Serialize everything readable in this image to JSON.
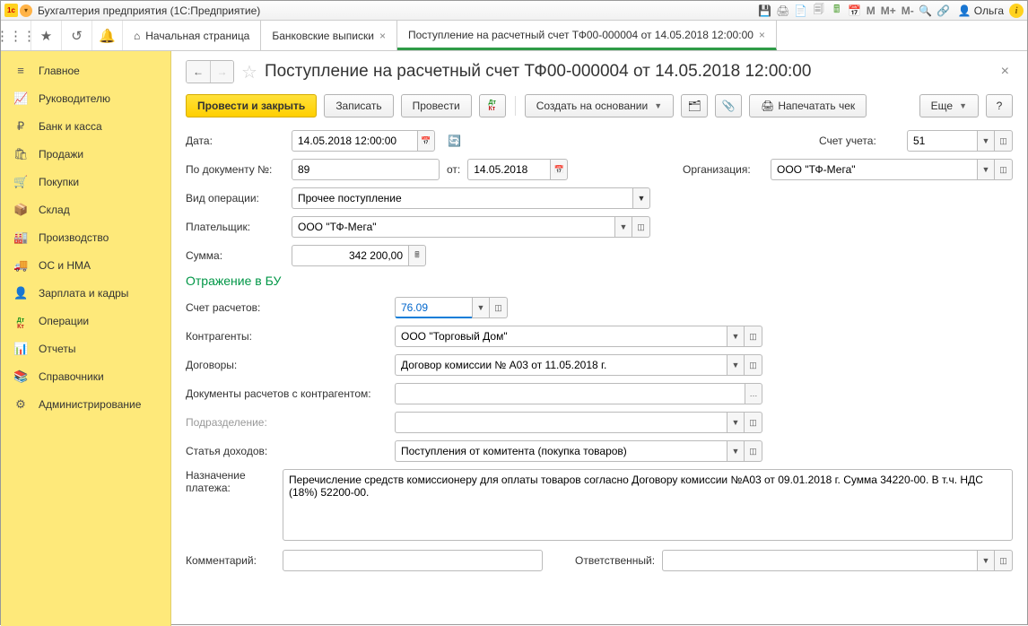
{
  "titlebar": {
    "app_title": "Бухгалтерия предприятия  (1С:Предприятие)",
    "user": "Ольга",
    "m": "М",
    "mplus": "М+",
    "mminus": "М-"
  },
  "tabs": {
    "home": "Начальная страница",
    "t1": "Банковские выписки",
    "t2": "Поступление на расчетный счет ТФ00-000004 от 14.05.2018 12:00:00"
  },
  "sidebar": [
    {
      "icon": "≡",
      "label": "Главное"
    },
    {
      "icon": "📈",
      "label": "Руководителю"
    },
    {
      "icon": "₽",
      "label": "Банк и касса"
    },
    {
      "icon": "🛍",
      "label": "Продажи"
    },
    {
      "icon": "🛒",
      "label": "Покупки"
    },
    {
      "icon": "📦",
      "label": "Склад"
    },
    {
      "icon": "🏭",
      "label": "Производство"
    },
    {
      "icon": "🚚",
      "label": "ОС и НМА"
    },
    {
      "icon": "👤",
      "label": "Зарплата и кадры"
    },
    {
      "icon": "Дт",
      "label": "Операции"
    },
    {
      "icon": "📊",
      "label": "Отчеты"
    },
    {
      "icon": "📚",
      "label": "Справочники"
    },
    {
      "icon": "⚙",
      "label": "Администрирование"
    }
  ],
  "page": {
    "title": "Поступление на расчетный счет ТФ00-000004 от 14.05.2018 12:00:00"
  },
  "toolbar": {
    "post_close": "Провести и закрыть",
    "write": "Записать",
    "post": "Провести",
    "create_based": "Создать на основании",
    "print_check": "Напечатать чек",
    "more": "Еще"
  },
  "form": {
    "date_lbl": "Дата:",
    "date_val": "14.05.2018 12:00:00",
    "acc_lbl": "Счет учета:",
    "acc_val": "51",
    "docnum_lbl": "По документу №:",
    "docnum_val": "89",
    "ot_lbl": "от:",
    "ot_val": "14.05.2018",
    "org_lbl": "Организация:",
    "org_val": "ООО \"ТФ-Мега\"",
    "optype_lbl": "Вид операции:",
    "optype_val": "Прочее поступление",
    "payer_lbl": "Плательщик:",
    "payer_val": "ООО \"ТФ-Мега\"",
    "sum_lbl": "Сумма:",
    "sum_val": "342 200,00",
    "section": "Отражение в БУ",
    "settle_lbl": "Счет расчетов:",
    "settle_val": "76.09",
    "contr_lbl": "Контрагенты:",
    "contr_val": "ООО \"Торговый Дом\"",
    "contracts_lbl": "Договоры:",
    "contracts_val": "Договор комиссии № А03 от 11.05.2018 г.",
    "docs_lbl": "Документы расчетов с контрагентом:",
    "docs_val": "",
    "dept_lbl": "Подразделение:",
    "dept_val": "",
    "income_lbl": "Статья доходов:",
    "income_val": "Поступления от комитента (покупка товаров)",
    "purpose_lbl": "Назначение платежа:",
    "purpose_val": "Перечисление средств комиссионеру для оплаты товаров согласно Договору комиссии №А03 от 09.01.2018 г. Сумма 34220-00. В т.ч. НДС (18%) 52200-00.",
    "comment_lbl": "Комментарий:",
    "comment_val": "",
    "resp_lbl": "Ответственный:",
    "resp_val": ""
  }
}
